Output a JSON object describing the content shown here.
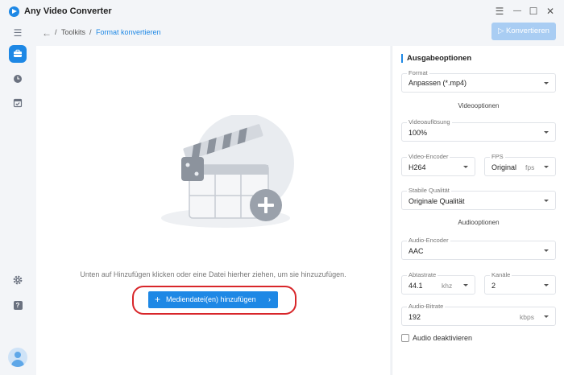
{
  "app": {
    "title": "Any Video Converter"
  },
  "window_controls": {
    "menu": "☰",
    "minimize": "—",
    "maximize": "☐",
    "close": "✕"
  },
  "breadcrumb": {
    "items": [
      "Toolkits",
      "Format konvertieren"
    ],
    "separator": "/"
  },
  "toolbar": {
    "convert_label": "Konvertieren",
    "convert_icon": "▷"
  },
  "sidebar": {
    "items": [
      {
        "name": "menu",
        "icon": "☰"
      },
      {
        "name": "toolkits",
        "icon": "briefcase",
        "active": true
      },
      {
        "name": "history",
        "icon": "clock"
      },
      {
        "name": "tasks",
        "icon": "check-list"
      },
      {
        "name": "settings",
        "icon": "gear"
      },
      {
        "name": "help",
        "icon": "?"
      }
    ]
  },
  "main": {
    "hint": "Unten auf Hinzufügen klicken oder eine Datei hierher ziehen, um sie hinzuzufügen.",
    "add_button": {
      "plus": "+",
      "label": "Mediendatei(en) hinzufügen",
      "arrow": "›"
    }
  },
  "output": {
    "title": "Ausgabeoptionen",
    "format": {
      "label": "Format",
      "value": "Anpassen (*.mp4)"
    },
    "video_section": "Videooptionen",
    "resolution": {
      "label": "Videoauflösung",
      "value": "100%"
    },
    "video_encoder": {
      "label": "Video-Encoder",
      "value": "H264"
    },
    "fps": {
      "label": "FPS",
      "value": "Original",
      "unit": "fps"
    },
    "quality": {
      "label": "Stabile Qualität",
      "value": "Originale Qualität"
    },
    "audio_section": "Audiooptionen",
    "audio_encoder": {
      "label": "Audio-Encoder",
      "value": "AAC"
    },
    "sample_rate": {
      "label": "Abtastrate",
      "value": "44.1",
      "unit": "khz"
    },
    "channels": {
      "label": "Kanäle",
      "value": "2"
    },
    "audio_bitrate": {
      "label": "Audio-Bitrate",
      "value": "192",
      "unit": "kbps"
    },
    "disable_audio": {
      "label": "Audio deaktivieren",
      "checked": false
    }
  },
  "colors": {
    "accent": "#1e88e5",
    "highlight": "#d8262a"
  }
}
